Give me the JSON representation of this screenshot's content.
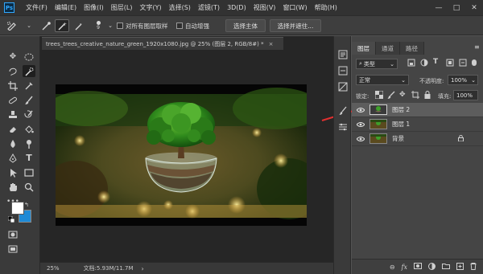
{
  "app": {
    "logo": "Ps"
  },
  "menu": [
    "文件(F)",
    "编辑(E)",
    "图像(I)",
    "图层(L)",
    "文字(Y)",
    "选择(S)",
    "滤镜(T)",
    "3D(D)",
    "视图(V)",
    "窗口(W)",
    "帮助(H)"
  ],
  "window_controls": {
    "minimize": "—",
    "maximize": "□",
    "close": "✕"
  },
  "options": {
    "brush_size": "9",
    "sample_all_layers": "对所有图层取样",
    "auto_enhance": "自动增强",
    "select_subject": "选择主体",
    "select_and_mask": "选择并遮住..."
  },
  "document": {
    "tab_title": "trees_trees_creative_nature_green_1920x1080.jpg @ 25% (图层 2, RGB/8#) *",
    "tab_close": "×",
    "zoom": "25%",
    "doc_info": "文档:5.93M/11.7M"
  },
  "layers_panel": {
    "tabs": [
      "图层",
      "通道",
      "路径"
    ],
    "filter_kind": "类型",
    "blend_mode": "正常",
    "opacity_label": "不透明度:",
    "opacity_value": "100%",
    "lock_label": "锁定:",
    "fill_label": "填充:",
    "fill_value": "100%",
    "layers": [
      {
        "name": "图层 2",
        "selected": true
      },
      {
        "name": "图层 1",
        "selected": false
      },
      {
        "name": "背景",
        "selected": false,
        "locked": true
      }
    ]
  },
  "colors": {
    "accent_blue": "#1e8ad6",
    "foreground": "#ffffff",
    "background_swatch": "#1e8ad6",
    "annotation_arrow": "#e03030"
  }
}
